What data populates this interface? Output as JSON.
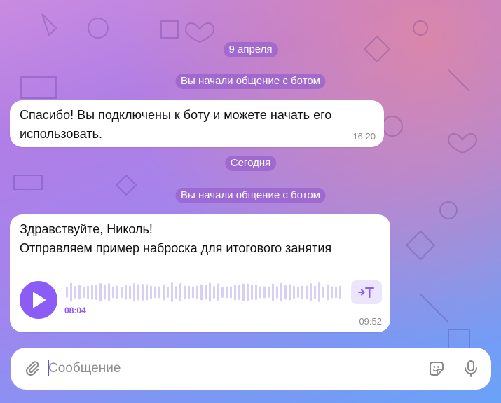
{
  "chat": {
    "date_1": "9 апреля",
    "service_1": "Вы начали общение с ботом",
    "message_1": {
      "text": "Спасибо! Вы подключены к боту и можете начать его использовать.",
      "time": "16:20"
    },
    "date_2": "Сегодня",
    "service_2": "Вы начали общение с ботом",
    "message_2": {
      "text": "Здравствуйте, Николь!\nОтправляем пример наброска для итогового занятия",
      "voice_duration": "08:04",
      "time": "09:52",
      "transcribe_icon": "transcribe-icon"
    }
  },
  "composer": {
    "placeholder": "Сообщение",
    "attach_icon": "paperclip-icon",
    "sticker_icon": "sticker-icon",
    "mic_icon": "microphone-icon"
  },
  "colors": {
    "accent": "#8b5cf6",
    "chip_background": "#965fcd"
  }
}
